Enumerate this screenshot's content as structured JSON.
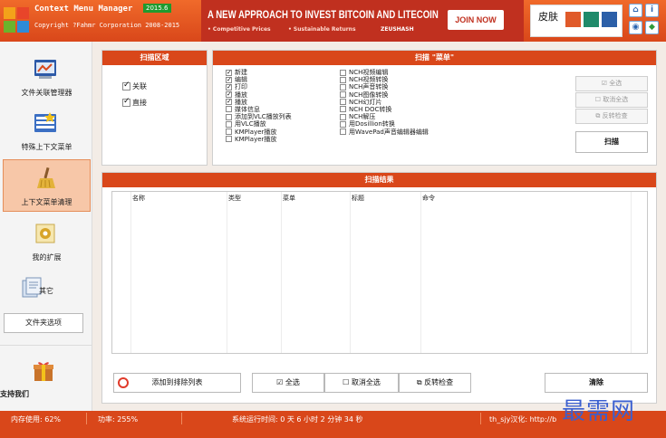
{
  "header": {
    "title": "Context Menu Manager",
    "version": "2015.6",
    "copyright": "Copyright ?Fahmr Corporation 2008-2015"
  },
  "ad": {
    "headline": "A NEW APPROACH TO INVEST BITCOIN AND LITECOIN",
    "feature1": "• Competitive Prices",
    "feature2": "• Sustainable Returns",
    "brand": "ZEUSHASH",
    "button": "JOIN NOW"
  },
  "skin": {
    "label": "皮肤",
    "colors": [
      "#e05a2a",
      "#1f8a6a",
      "#2b5fa8"
    ]
  },
  "header_icons": [
    "home-icon",
    "info-icon",
    "wireless-icon",
    "update-icon"
  ],
  "sidebar": {
    "items": [
      {
        "label": "文件关联管理器",
        "icon": "file-association-icon"
      },
      {
        "label": "特殊上下文菜单",
        "icon": "special-menu-icon"
      },
      {
        "label": "上下文菜单清理",
        "icon": "broom-icon",
        "active": true
      },
      {
        "label": "我的扩展",
        "icon": "extension-gear-icon"
      },
      {
        "label": "其它",
        "icon": "other-icon"
      }
    ],
    "folder_options": "文件夹选项",
    "support": "支持我们"
  },
  "scan_area": {
    "title": "扫描区域",
    "options": [
      {
        "label": "关联",
        "checked": true
      },
      {
        "label": "直接",
        "checked": true
      }
    ]
  },
  "scan_menu": {
    "title": "扫描 \"菜单\"",
    "col1": [
      {
        "label": "新建",
        "checked": true
      },
      {
        "label": "编辑",
        "checked": true
      },
      {
        "label": "打印",
        "checked": true
      },
      {
        "label": "播放",
        "checked": true
      },
      {
        "label": "播放",
        "checked": true
      },
      {
        "label": "媒体信息",
        "checked": false
      },
      {
        "label": "添加到VLC播放列表",
        "checked": false
      },
      {
        "label": "用VLC播放",
        "checked": false
      },
      {
        "label": "KMPlayer播放",
        "checked": false
      },
      {
        "label": "KMPlayer播放",
        "checked": false
      }
    ],
    "col2": [
      {
        "label": "NCH视频编辑",
        "checked": false
      },
      {
        "label": "NCH视频转换",
        "checked": false
      },
      {
        "label": "NCH声音转换",
        "checked": false
      },
      {
        "label": "NCH图像转换",
        "checked": false
      },
      {
        "label": "NCH幻灯片",
        "checked": false
      },
      {
        "label": "NCH DOC转换",
        "checked": false
      },
      {
        "label": "NCH解压",
        "checked": false
      },
      {
        "label": "用Dosillion转换",
        "checked": false
      },
      {
        "label": "用WavePad声音编辑器编辑",
        "checked": false
      }
    ],
    "select_all": "全选",
    "deselect_all": "取消全选",
    "invert": "反转检查",
    "scan_button": "扫描"
  },
  "results": {
    "title": "扫描结果",
    "columns": [
      "名称",
      "类型",
      "菜单",
      "标题",
      "命令"
    ],
    "add_exclude": "添加到排除列表",
    "select_all": "全选",
    "deselect_all": "取消全选",
    "invert": "反转检查",
    "clean": "清除"
  },
  "status": {
    "memory": "内存使用: 62%",
    "power": "功率: 255%",
    "uptime": "系统运行时间: 0 天 6 小时 2 分钟 34 秒",
    "credit": "th_sjy汉化: http://b",
    "watermark": "最需网"
  }
}
